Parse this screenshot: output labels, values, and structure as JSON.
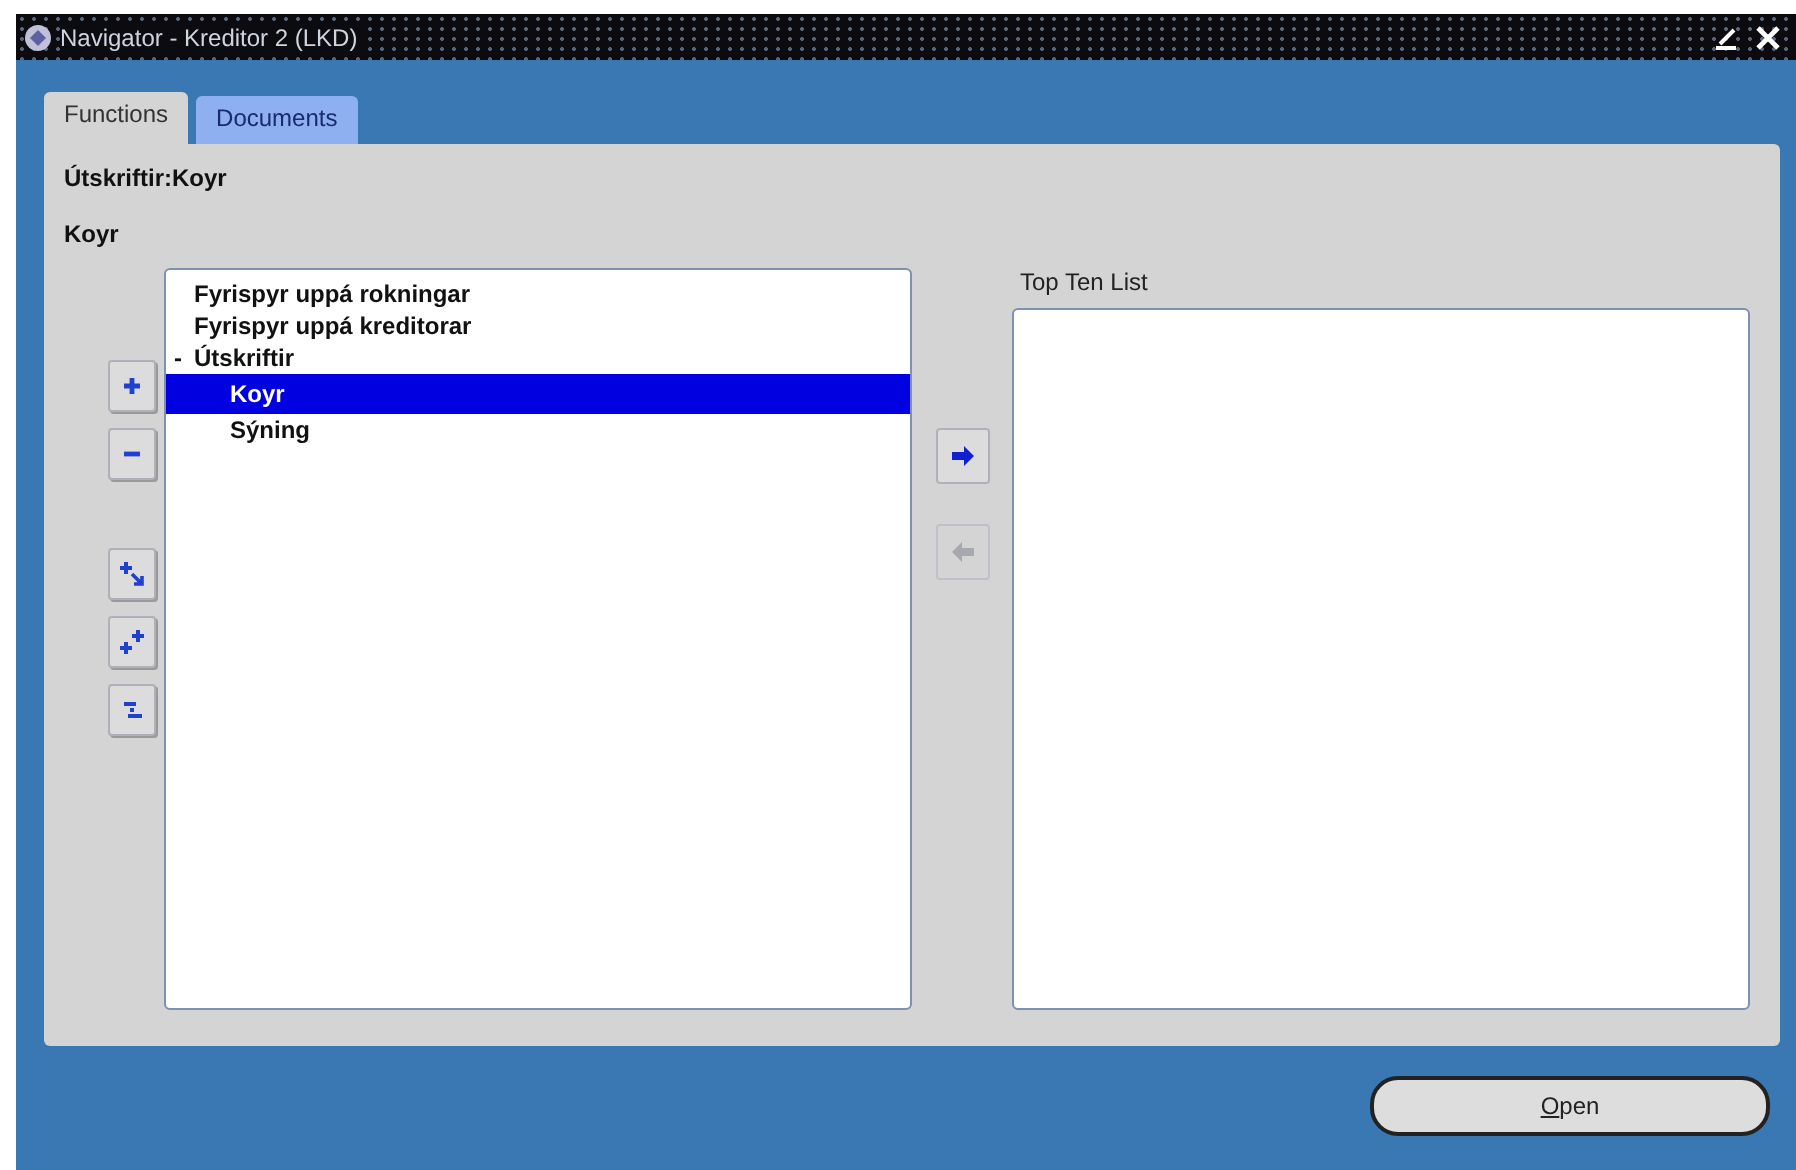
{
  "window": {
    "title": "Navigator - Kreditor 2 (LKD)"
  },
  "tabs": [
    {
      "label": "Functions",
      "selected": true
    },
    {
      "label": "Documents",
      "selected": false
    }
  ],
  "breadcrumb": "Útskriftir:Koyr",
  "current": "Koyr",
  "tree_buttons": [
    {
      "kind": "expand"
    },
    {
      "kind": "collapse"
    },
    {
      "kind": "expand-branch"
    },
    {
      "kind": "expand-all"
    },
    {
      "kind": "collapse-all"
    }
  ],
  "tree": [
    {
      "label": "Fyrispyr uppá rokningar",
      "selected": false
    },
    {
      "label": "Fyrispyr uppá kreditorar",
      "selected": false
    },
    {
      "label": "Útskriftir",
      "toggle": "-",
      "selected": false,
      "children": [
        {
          "label": "Koyr",
          "selected": true
        },
        {
          "label": "Sýning",
          "selected": false
        }
      ]
    }
  ],
  "transfer_buttons": [
    {
      "kind": "add",
      "disabled": false
    },
    {
      "kind": "remove",
      "disabled": true
    }
  ],
  "top_ten": {
    "label": "Top Ten List"
  },
  "open_button": {
    "label": "Open"
  }
}
